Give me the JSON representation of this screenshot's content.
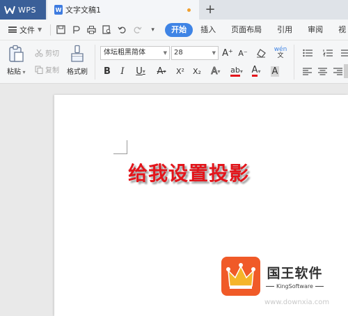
{
  "tabs": {
    "app_label": "WPS",
    "doc_label": "文字文稿1",
    "add": "+"
  },
  "menu": {
    "file_label": "文件",
    "ribbon_tabs": [
      "开始",
      "插入",
      "页面布局",
      "引用",
      "审阅",
      "视"
    ],
    "active_tab": "开始"
  },
  "toolbar": {
    "paste_label": "粘贴",
    "cut_label": "剪切",
    "copy_label": "复制",
    "format_painter_label": "格式刷",
    "font_name": "体坛粗黑简体",
    "font_size": "28",
    "bold": "B",
    "italic": "I",
    "underline": "U",
    "strike": "A",
    "superscript": "X²",
    "subscript": "X₂",
    "text_effect": "A",
    "highlight": "ab",
    "font_color": "A",
    "char_shading": "A",
    "grow": "A⁺",
    "shrink": "A⁻",
    "phonetic": "wén"
  },
  "document": {
    "heading_text": "给我设置投影",
    "heading_color": "#e3151b"
  },
  "watermark": {
    "brand_cn": "国王软件",
    "brand_en": "KingSoftware",
    "url": "www.downxia.com"
  },
  "colors": {
    "accent": "#3f84e5",
    "wps_tab": "#3a5f98",
    "logo": "#f05a28"
  }
}
